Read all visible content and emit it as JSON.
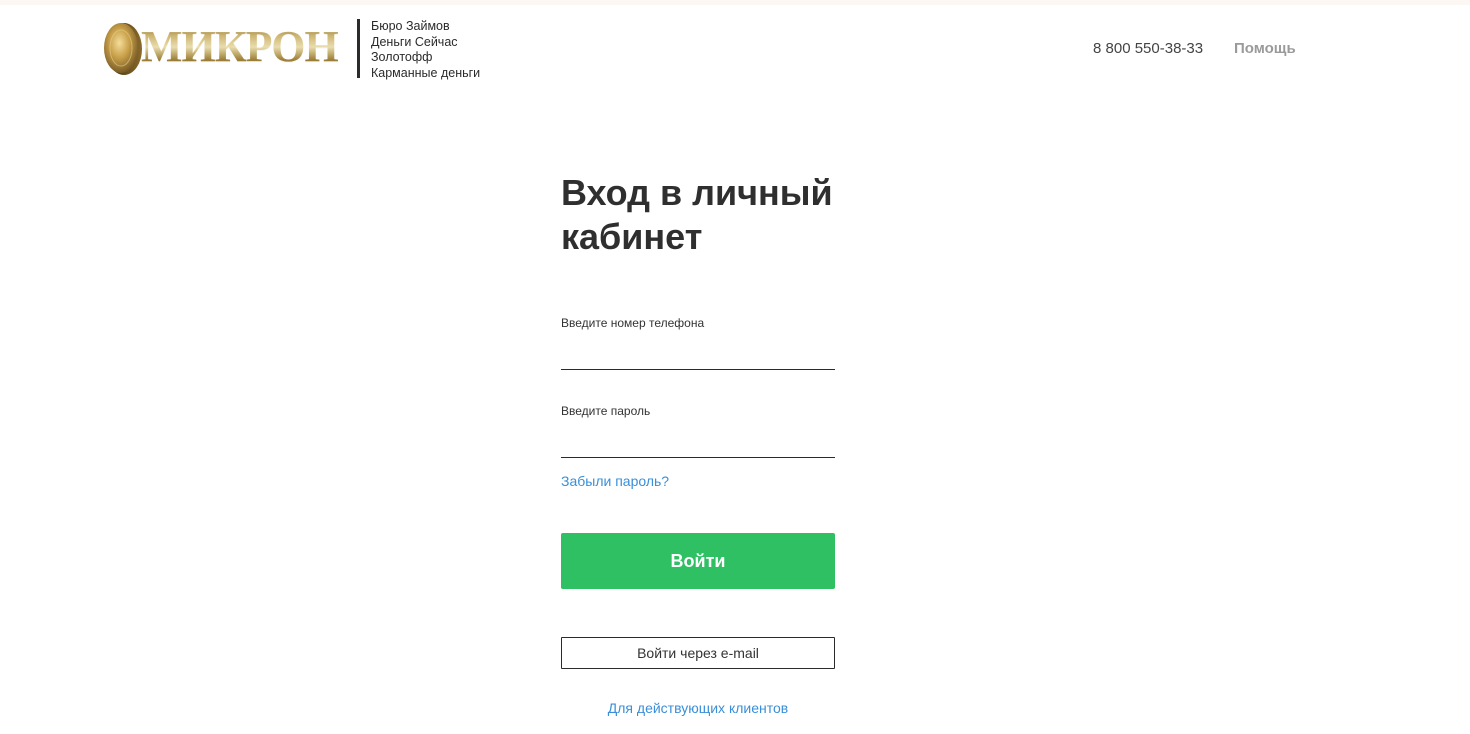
{
  "header": {
    "logo_text": "МИКРОН",
    "brands": [
      "Бюро Займов",
      "Деньги Сейчас",
      "Золотофф",
      "Карманные деньги"
    ],
    "phone": "8 800 550-38-33",
    "help_label": "Помощь"
  },
  "login_form": {
    "title": "Вход в личный кабинет",
    "phone_label": "Введите номер телефона",
    "phone_value": "",
    "password_label": "Введите пароль",
    "password_value": "",
    "forgot_label": "Забыли пароль?",
    "submit_label": "Войти",
    "email_login_label": "Войти через e-mail",
    "existing_clients_label": "Для действующих клиентов"
  },
  "colors": {
    "accent_green": "#2ec063",
    "link_blue": "#3a8fd8",
    "text_dark": "#2b2b2b",
    "logo_gold": "#c9a85c"
  },
  "icons": {
    "logo": "gold-coin-icon"
  }
}
